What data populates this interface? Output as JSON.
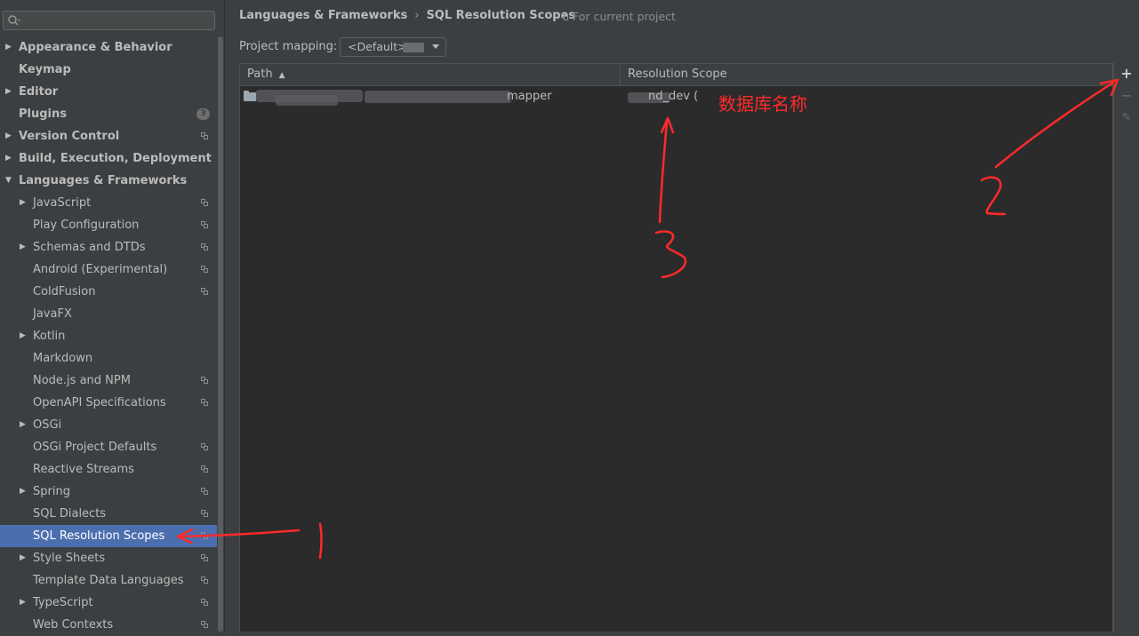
{
  "sidebar": {
    "search_placeholder": "",
    "items": [
      {
        "label": "Appearance & Behavior",
        "level": 0,
        "arrow": "▶",
        "icon": "",
        "badge": ""
      },
      {
        "label": "Keymap",
        "level": 0,
        "arrow": "",
        "icon": "",
        "badge": ""
      },
      {
        "label": "Editor",
        "level": 0,
        "arrow": "▶",
        "icon": "",
        "badge": ""
      },
      {
        "label": "Plugins",
        "level": 0,
        "arrow": "",
        "icon": "",
        "badge": "3"
      },
      {
        "label": "Version Control",
        "level": 0,
        "arrow": "▶",
        "icon": "project-icon",
        "badge": ""
      },
      {
        "label": "Build, Execution, Deployment",
        "level": 0,
        "arrow": "▶",
        "icon": "",
        "badge": ""
      },
      {
        "label": "Languages & Frameworks",
        "level": 0,
        "arrow": "▼",
        "icon": "",
        "badge": ""
      },
      {
        "label": "JavaScript",
        "level": 1,
        "arrow": "▶",
        "icon": "project-icon",
        "badge": ""
      },
      {
        "label": "Play Configuration",
        "level": 1,
        "arrow": "",
        "icon": "project-icon",
        "badge": ""
      },
      {
        "label": "Schemas and DTDs",
        "level": 1,
        "arrow": "▶",
        "icon": "project-icon",
        "badge": ""
      },
      {
        "label": "Android (Experimental)",
        "level": 1,
        "arrow": "",
        "icon": "project-icon",
        "badge": ""
      },
      {
        "label": "ColdFusion",
        "level": 1,
        "arrow": "",
        "icon": "project-icon",
        "badge": ""
      },
      {
        "label": "JavaFX",
        "level": 1,
        "arrow": "",
        "icon": "",
        "badge": ""
      },
      {
        "label": "Kotlin",
        "level": 1,
        "arrow": "▶",
        "icon": "",
        "badge": ""
      },
      {
        "label": "Markdown",
        "level": 1,
        "arrow": "",
        "icon": "",
        "badge": ""
      },
      {
        "label": "Node.js and NPM",
        "level": 1,
        "arrow": "",
        "icon": "project-icon",
        "badge": ""
      },
      {
        "label": "OpenAPI Specifications",
        "level": 1,
        "arrow": "",
        "icon": "project-icon",
        "badge": ""
      },
      {
        "label": "OSGi",
        "level": 1,
        "arrow": "▶",
        "icon": "",
        "badge": ""
      },
      {
        "label": "OSGi Project Defaults",
        "level": 1,
        "arrow": "",
        "icon": "project-icon",
        "badge": ""
      },
      {
        "label": "Reactive Streams",
        "level": 1,
        "arrow": "",
        "icon": "project-icon",
        "badge": ""
      },
      {
        "label": "Spring",
        "level": 1,
        "arrow": "▶",
        "icon": "project-icon",
        "badge": ""
      },
      {
        "label": "SQL Dialects",
        "level": 1,
        "arrow": "",
        "icon": "project-icon",
        "badge": ""
      },
      {
        "label": "SQL Resolution Scopes",
        "level": 1,
        "arrow": "",
        "icon": "project-icon",
        "badge": "",
        "selected": true
      },
      {
        "label": "Style Sheets",
        "level": 1,
        "arrow": "▶",
        "icon": "project-icon",
        "badge": ""
      },
      {
        "label": "Template Data Languages",
        "level": 1,
        "arrow": "",
        "icon": "project-icon",
        "badge": ""
      },
      {
        "label": "TypeScript",
        "level": 1,
        "arrow": "▶",
        "icon": "project-icon",
        "badge": ""
      },
      {
        "label": "Web Contexts",
        "level": 1,
        "arrow": "",
        "icon": "project-icon",
        "badge": ""
      }
    ]
  },
  "header": {
    "breadcrumb_parent": "Languages & Frameworks",
    "breadcrumb_sep": "›",
    "breadcrumb_current": "SQL Resolution Scopes",
    "scope_note": "For current project"
  },
  "mapping": {
    "label": "Project mapping:",
    "value": "<Default>"
  },
  "table": {
    "columns": {
      "path": "Path",
      "scope": "Resolution Scope"
    },
    "sort_glyph": "▲",
    "rows": [
      {
        "path_visible": "mapper",
        "scope_visible": "nd_dev ("
      }
    ]
  },
  "toolbar": {
    "add": "+",
    "remove": "−",
    "edit": "✎"
  },
  "annotations": {
    "db_name_note": "数据库名称",
    "color": "#ff2a2a"
  }
}
